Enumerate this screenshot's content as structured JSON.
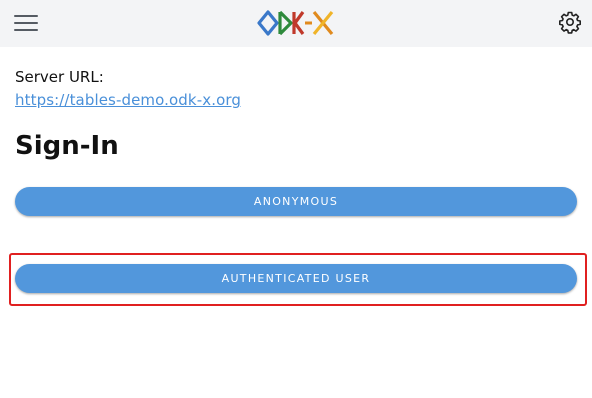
{
  "header": {
    "menu_icon": "hamburger-menu-icon",
    "logo_name": "odk-x-logo",
    "settings_icon": "gear-icon",
    "logo_colors": {
      "o": "#3a78c9",
      "d": "#2e8a3c",
      "k": "#c0392b",
      "x_left": "#e08a1e",
      "x_right": "#f0b429"
    }
  },
  "server": {
    "label": "Server URL:",
    "url": "https://tables-demo.odk-x.org"
  },
  "signin": {
    "title": "Sign-In",
    "anonymous_label": "ANONYMOUS",
    "authenticated_label": "AUTHENTICATED USER"
  },
  "colors": {
    "accent": "#5297dc",
    "link": "#4a90d9",
    "highlight": "#e02020",
    "topbar": "#f3f4f6"
  }
}
